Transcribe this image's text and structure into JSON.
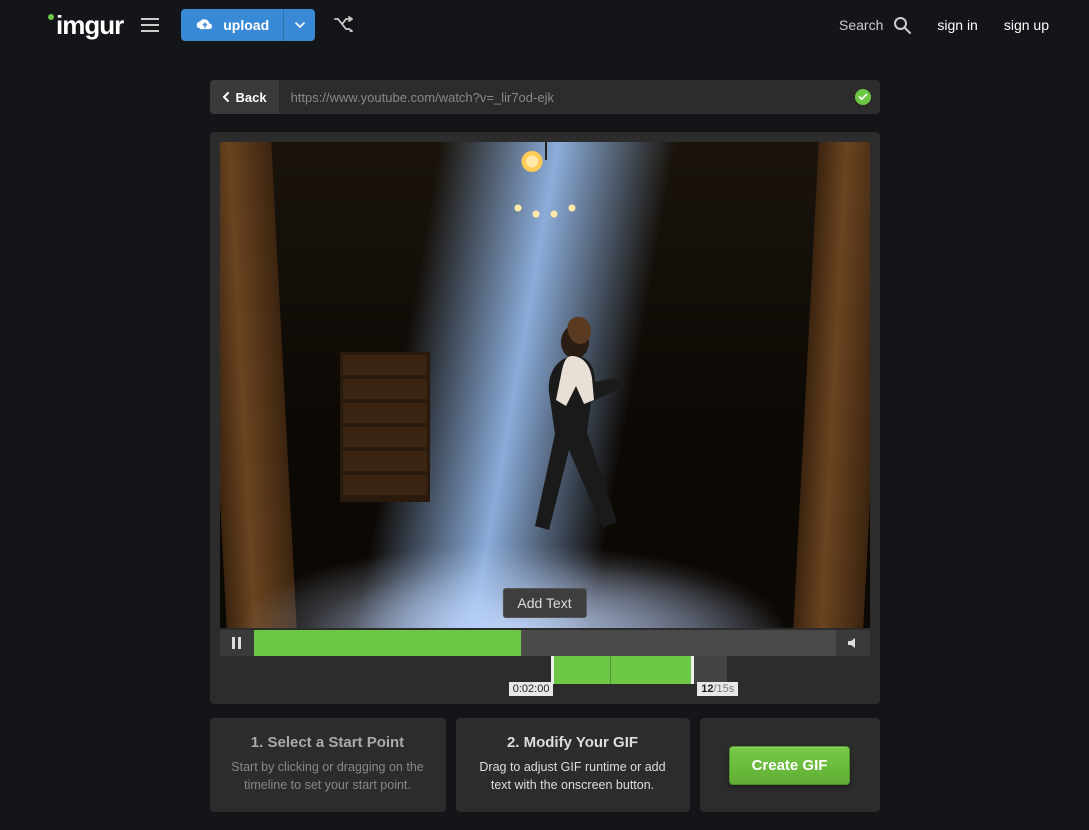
{
  "nav": {
    "logo_text": "imgur",
    "upload_label": "upload",
    "search_label": "Search",
    "signin_label": "sign in",
    "signup_label": "sign up"
  },
  "urlbar": {
    "back_label": "Back",
    "url": "https://www.youtube.com/watch?v=_lir7od-ejk"
  },
  "editor": {
    "add_text_label": "Add Text",
    "progress_percent": 46,
    "range": {
      "start_label": "0:02:00",
      "length_label": "12",
      "max_label": "/15s",
      "sel_left_percent": 51,
      "sel_width_percent": 22,
      "after_width_percent": 5
    }
  },
  "instructions": {
    "step1_title": "1. Select a Start Point",
    "step1_body": "Start by clicking or dragging on the timeline to set your start point.",
    "step2_title": "2. Modify Your GIF",
    "step2_body": "Drag to adjust GIF runtime or add text with the onscreen button.",
    "create_label": "Create GIF"
  }
}
